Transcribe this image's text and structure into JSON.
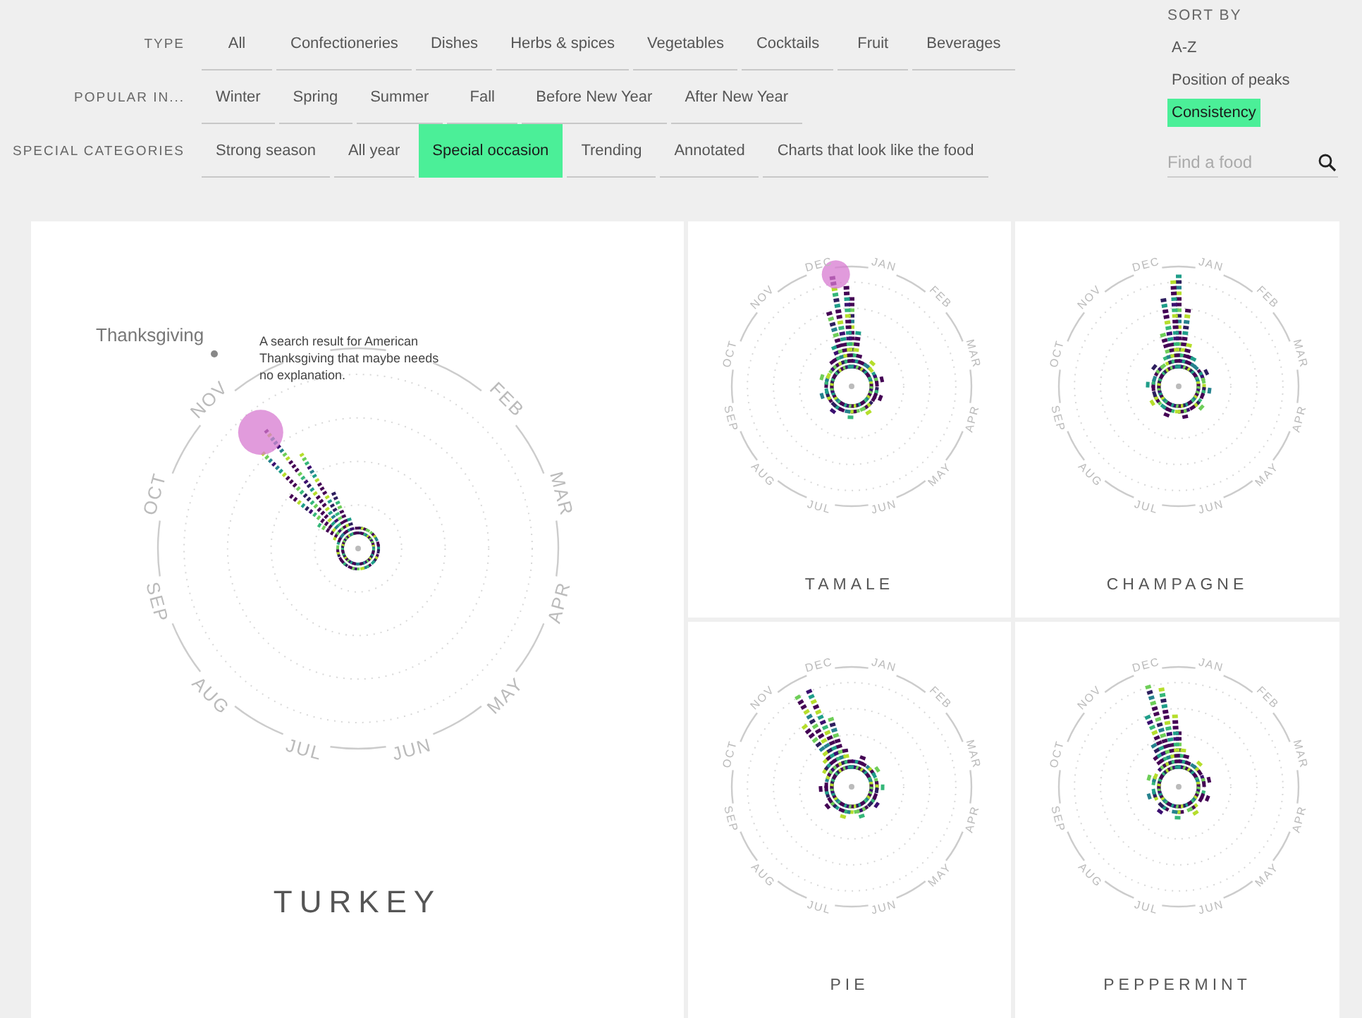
{
  "filters": [
    {
      "label": "TYPE",
      "options": [
        {
          "label": "All",
          "selected": false
        },
        {
          "label": "Confectioneries",
          "selected": false
        },
        {
          "label": "Dishes",
          "selected": false
        },
        {
          "label": "Herbs & spices",
          "selected": false
        },
        {
          "label": "Vegetables",
          "selected": false
        },
        {
          "label": "Cocktails",
          "selected": false
        },
        {
          "label": "Fruit",
          "selected": false
        },
        {
          "label": "Beverages",
          "selected": false
        }
      ]
    },
    {
      "label": "POPULAR IN...",
      "options": [
        {
          "label": "Winter",
          "selected": false
        },
        {
          "label": "Spring",
          "selected": false
        },
        {
          "label": "Summer",
          "selected": false
        },
        {
          "label": "Fall",
          "selected": false
        },
        {
          "label": "Before New Year",
          "selected": false
        },
        {
          "label": "After New Year",
          "selected": false
        }
      ]
    },
    {
      "label": "SPECIAL CATEGORIES",
      "options": [
        {
          "label": "Strong season",
          "selected": false
        },
        {
          "label": "All year",
          "selected": false
        },
        {
          "label": "Special occasion",
          "selected": true
        },
        {
          "label": "Trending",
          "selected": false
        },
        {
          "label": "Annotated",
          "selected": false
        },
        {
          "label": "Charts that look like the food",
          "selected": false
        }
      ]
    }
  ],
  "sort_by": {
    "label": "SORT BY",
    "options": [
      {
        "label": "A-Z",
        "selected": false
      },
      {
        "label": "Position of peaks",
        "selected": false
      },
      {
        "label": "Consistency",
        "selected": true
      }
    ]
  },
  "search": {
    "placeholder": "Find a food"
  },
  "cards": [
    {
      "kind": "large",
      "name": "TURKEY",
      "highlighted": true,
      "months": [
        "FEB",
        "MAR",
        "APR",
        "MAY",
        "JUN",
        "JUL",
        "AUG",
        "SEP",
        "OCT",
        "NOV"
      ],
      "annotation": {
        "label": "Thanksgiving",
        "note": "A search result for American Thanksgiving that maybe needs no explanation."
      }
    },
    {
      "kind": "small",
      "name": "TAMALE",
      "highlighted": true,
      "months": [
        "JAN",
        "FEB",
        "MAR",
        "APR",
        "MAY",
        "JUN",
        "JUL",
        "AUG",
        "SEP",
        "OCT",
        "NOV",
        "DEC"
      ]
    },
    {
      "kind": "small",
      "name": "CHAMPAGNE",
      "highlighted": false,
      "months": [
        "JAN",
        "FEB",
        "MAR",
        "APR",
        "MAY",
        "JUN",
        "JUL",
        "AUG",
        "SEP",
        "OCT",
        "NOV",
        "DEC"
      ]
    },
    {
      "kind": "small",
      "name": "PIE",
      "highlighted": false,
      "months": [
        "JAN",
        "FEB",
        "MAR",
        "APR",
        "MAY",
        "JUN",
        "JUL",
        "AUG",
        "SEP",
        "OCT",
        "NOV",
        "DEC"
      ]
    },
    {
      "kind": "small",
      "name": "PEPPERMINT",
      "highlighted": false,
      "months": [
        "JAN",
        "FEB",
        "MAR",
        "APR",
        "MAY",
        "JUN",
        "JUL",
        "AUG",
        "SEP",
        "OCT",
        "NOV",
        "DEC"
      ]
    }
  ]
}
